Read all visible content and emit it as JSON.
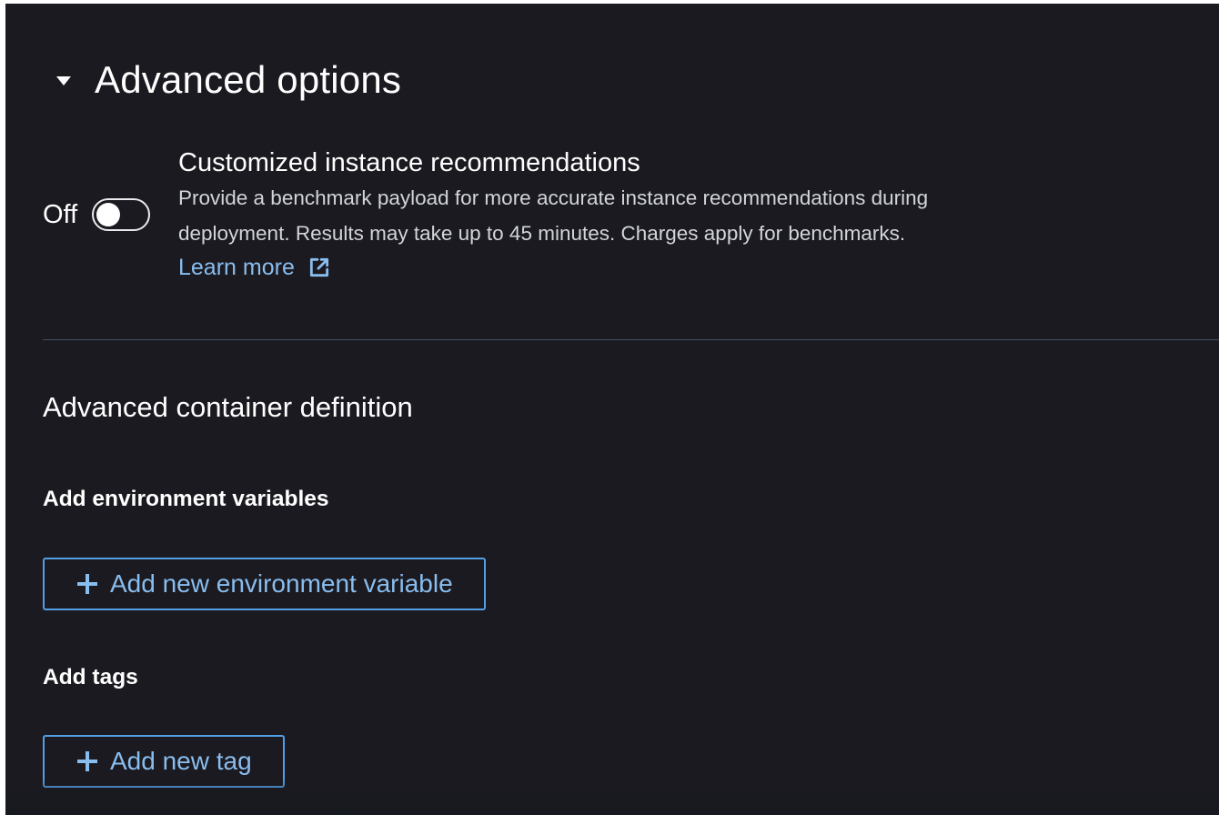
{
  "advanced_options": {
    "title": "Advanced options",
    "expanded": true
  },
  "instance_recommendations": {
    "toggle_state_label": "Off",
    "toggle_on": false,
    "title": "Customized instance recommendations",
    "description_line1": "Provide a benchmark payload for more accurate instance recommendations during",
    "description_line2": "deployment. Results may take up to 45 minutes. Charges apply for benchmarks.",
    "learn_more_label": "Learn more",
    "learn_more_icon": "external-link-icon"
  },
  "container_definition": {
    "heading": "Advanced container definition",
    "env_vars_label": "Add environment variables",
    "add_env_var_button": "Add new environment variable",
    "tags_label": "Add tags",
    "add_tag_button": "Add new tag",
    "button_icon": "plus-icon"
  },
  "colors": {
    "background": "#1b1a20",
    "text": "#ffffff",
    "muted_text": "#d1d5db",
    "link": "#89bdee",
    "button_border": "#539fe5",
    "divider": "#414d5c"
  }
}
